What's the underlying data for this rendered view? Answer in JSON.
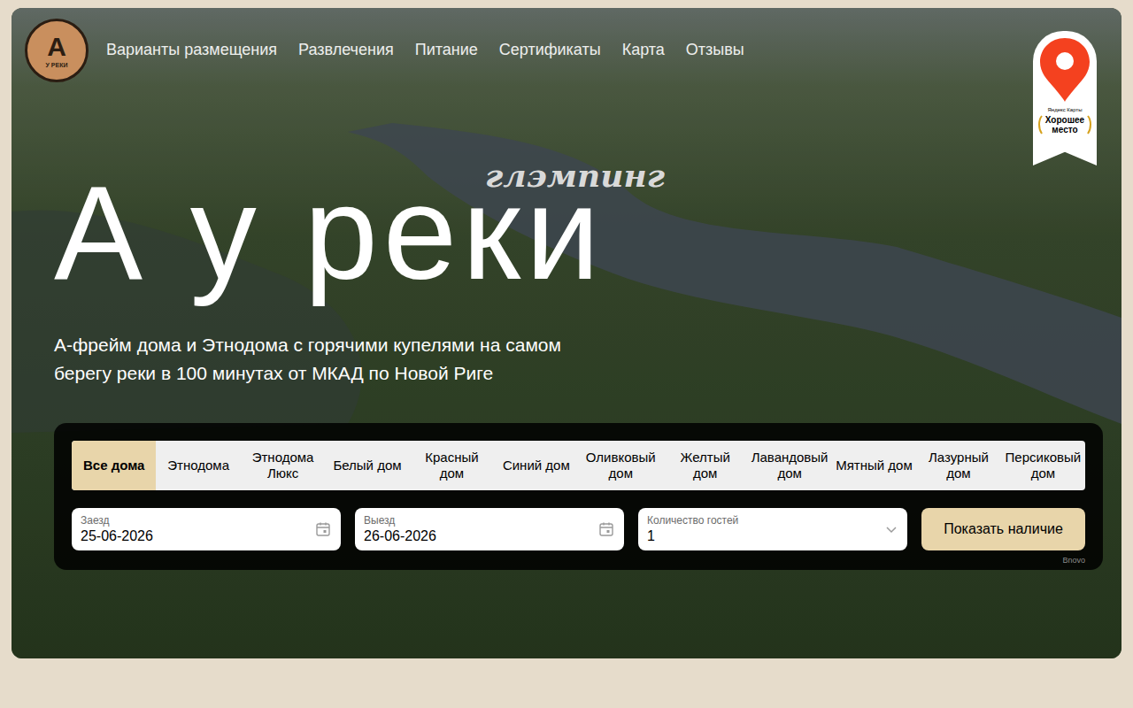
{
  "logo": {
    "letter": "А",
    "caption": "У РЕКИ"
  },
  "nav": [
    "Варианты размещения",
    "Развлечения",
    "Питание",
    "Сертификаты",
    "Карта",
    "Отзывы"
  ],
  "badge": {
    "brand": "Яндекс Карты",
    "label": "Хорошее место"
  },
  "hero": {
    "title": "А у реки",
    "tag": "глэмпинг",
    "subtitle": "А-фрейм дома и Этнодома с горячими купелями на самом берегу реки в 100 минутах от МКАД по Новой Риге"
  },
  "booking": {
    "tabs": [
      {
        "label": "Все дома",
        "selected": true
      },
      {
        "label": "Этнодома",
        "selected": false
      },
      {
        "label": "Этнодома Люкс",
        "selected": false
      },
      {
        "label": "Белый дом",
        "selected": false
      },
      {
        "label": "Красный дом",
        "selected": false
      },
      {
        "label": "Синий дом",
        "selected": false
      },
      {
        "label": "Оливковый дом",
        "selected": false
      },
      {
        "label": "Желтый дом",
        "selected": false
      },
      {
        "label": "Лавандовый дом",
        "selected": false
      },
      {
        "label": "Мятный дом",
        "selected": false
      },
      {
        "label": "Лазурный дом",
        "selected": false
      },
      {
        "label": "Персиковый дом",
        "selected": false
      }
    ],
    "fields": [
      {
        "label": "Заезд",
        "value": "25-06-2026",
        "kind": "date"
      },
      {
        "label": "Выезд",
        "value": "26-06-2026",
        "kind": "date"
      },
      {
        "label": "Количество гостей",
        "value": "1",
        "kind": "select"
      }
    ],
    "button": "Показать наличие",
    "powered": "Bnovo"
  }
}
